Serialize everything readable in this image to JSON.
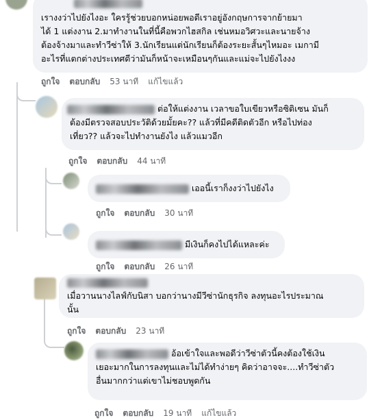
{
  "labels": {
    "like": "ถูกใจ",
    "reply": "ตอบกลับ",
    "edited": "แก้ไขแล้ว"
  },
  "comments": [
    {
      "lines": [
        "เรางงว่าไปยังไงอะ ใครรู้ช่วยบอกหน่อยพอดีเราอยู่อังกฤษการจากย้ายมา",
        "ได้ 1 แต่งงาน 2.มาทำงานในที่นี้คือพวกไฮสกิล เช่นหมอวิศวะและนายจ้าง",
        "ต้องจ้างมาและทำวีซ่าให้ 3.นักเรียนแต่นักเรียนก็ต้องระยะสั้นๆไหมอะ เมกามี",
        "อะไรที่แตกต่างประเทศดีว่ามันก็หน้าจะเหมือนๆกันและแม่จะไปยังไงงง"
      ],
      "time": "53 นาที",
      "edited": true
    },
    {
      "lines": [
        "ต่อให้แต่งงาน เวลาขอใบเขียวหรือซิติเซน มันก็",
        "ต้องมีตรวจสอบประวัติด้วยมั้ยคะ?? แล้วที่มีคดีติดตัวอีก หรือไปท่อง",
        "เที่ยว?? แล้วจะไปทำงานยังไง แล้วแมวอีก"
      ],
      "time": "44 นาที"
    },
    {
      "lines": [
        "เออนี้เราก็งงว่าไปยังไง"
      ],
      "time": "30 นาที"
    },
    {
      "lines": [
        "มีเงินก็คงไปได้แหละค่ะ"
      ],
      "time": "26 นาที"
    },
    {
      "lines": [
        "เมื่อวานนางไลฟ์กับนิสา บอกว่านางมีวีซ่านักธุรกิจ ลงทุนอะไรประมาณ",
        "นั้น"
      ],
      "time": "23 นาที"
    },
    {
      "lines": [
        "อ้อเข้าใจและพอดีว่าวีซ่าตัวนี้คงต้องใช้เงิน",
        "เยอะมากในการลงทุนและไม่ได้ทำง่ายๆ คิดว่าอาจจะ....ทำวีซ่าตัว",
        "อื่นมากกว่าแต่เขาไม่ชอบพูดกัน"
      ],
      "time": "19 นาที",
      "edited": true
    }
  ]
}
